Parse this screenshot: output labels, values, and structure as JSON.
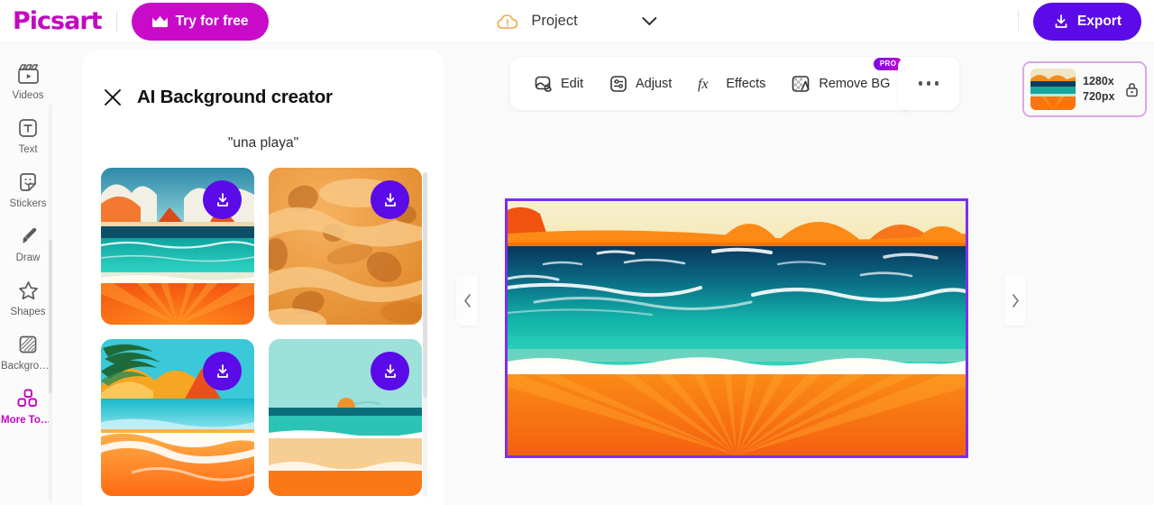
{
  "header": {
    "logo": "Picsart",
    "try_free_label": "Try for free",
    "crown_icon": "crown-icon",
    "cloud_icon": "cloud-alert-icon",
    "project_name": "Project",
    "chevron_icon": "chevron-down-icon",
    "export_label": "Export",
    "export_icon": "download-icon",
    "accent_purple": "#5B0AE8",
    "brand_magenta": "#C209C1"
  },
  "sidebar": {
    "items": [
      {
        "label": "Videos",
        "icon": "clapperboard-icon",
        "active": false
      },
      {
        "label": "Text",
        "icon": "text-box-icon",
        "active": false
      },
      {
        "label": "Stickers",
        "icon": "sticker-icon",
        "active": false
      },
      {
        "label": "Draw",
        "icon": "brush-icon",
        "active": false
      },
      {
        "label": "Shapes",
        "icon": "star-icon",
        "active": false
      },
      {
        "label": "Backgrou…",
        "icon": "pattern-icon",
        "active": false
      },
      {
        "label": "More Tools",
        "icon": "grid-blocks-icon",
        "active": true
      }
    ]
  },
  "panel": {
    "close_icon": "close-icon",
    "title": "AI Background creator",
    "prompt": "\"una playa\"",
    "download_icon": "download-icon",
    "results": [
      {
        "name": "beach-clouds-sunrays",
        "download_label": "Download"
      },
      {
        "name": "abstract-orange-dunes",
        "download_label": "Download"
      },
      {
        "name": "palm-beach-shoreline",
        "download_label": "Download"
      },
      {
        "name": "flat-minimal-beach-sun",
        "download_label": "Download"
      }
    ]
  },
  "toolbar": {
    "tools": [
      {
        "label": "Edit",
        "icon": "image-edit-icon",
        "pro": null
      },
      {
        "label": "Adjust",
        "icon": "sliders-icon",
        "pro": null
      },
      {
        "label": "Effects",
        "icon": "fx-icon",
        "pro": null
      },
      {
        "label": "Remove BG",
        "icon": "remove-bg-icon",
        "pro": "PRO"
      }
    ],
    "more_icon": "more-horizontal-icon"
  },
  "size_chip": {
    "width_label": "1280x",
    "height_label": "720px",
    "lock_icon": "lock-icon",
    "border_color": "#DDA6E8"
  },
  "canvas": {
    "selection_color": "#7B2FF2",
    "image_name": "beach-sunrays-background",
    "prev_icon": "chevron-left-icon",
    "next_icon": "chevron-right-icon"
  }
}
